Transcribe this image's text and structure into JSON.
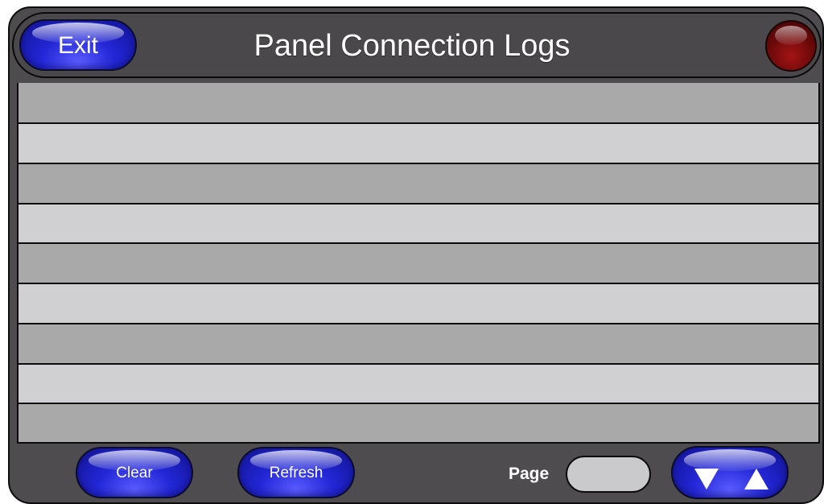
{
  "header": {
    "title": "Panel Connection Logs",
    "exit_label": "Exit"
  },
  "status_light": {
    "color": "#8b0d0d",
    "icon": "status-light"
  },
  "log_rows": [
    "",
    "",
    "",
    "",
    "",
    "",
    "",
    "",
    ""
  ],
  "footer": {
    "clear_label": "Clear",
    "refresh_label": "Refresh",
    "page_label": "Page",
    "page_value": "",
    "nav_down_icon": "arrow-down-icon",
    "nav_up_icon": "arrow-up-icon"
  },
  "colors": {
    "frame": "#4e4c4e",
    "button_blue": "#2327d6",
    "row_dark": "#aaa9aa",
    "row_light": "#d0cfd1"
  }
}
